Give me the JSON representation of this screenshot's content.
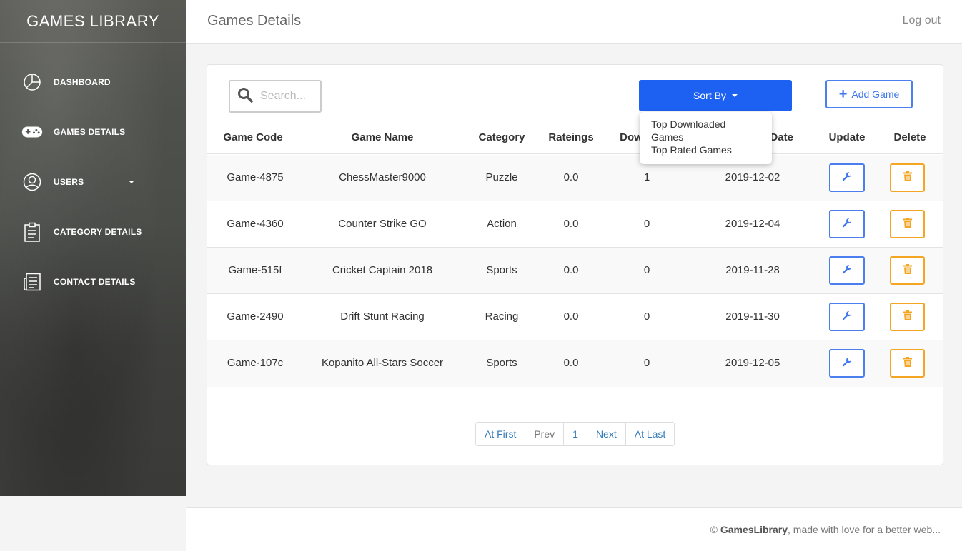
{
  "sidebar": {
    "brand": "GAMES LIBRARY",
    "items": [
      {
        "label": "DASHBOARD",
        "icon": "pie-chart-icon"
      },
      {
        "label": "GAMES DETAILS",
        "icon": "gamepad-icon"
      },
      {
        "label": "USERS",
        "icon": "user-icon"
      },
      {
        "label": "CATEGORY DETAILS",
        "icon": "clipboard-icon"
      },
      {
        "label": "CONTACT DETAILS",
        "icon": "news-icon"
      }
    ]
  },
  "header": {
    "title": "Games Details",
    "logout": "Log out"
  },
  "toolbar": {
    "search_placeholder": "Search...",
    "sort_label": "Sort By",
    "add_label": "Add Game",
    "sort_options": [
      "Top Downloaded Games",
      "Top Rated Games"
    ]
  },
  "table": {
    "columns": [
      "Game Code",
      "Game Name",
      "Category",
      "Rateings",
      "Dow",
      "d Date",
      "Update",
      "Delete"
    ],
    "rows": [
      {
        "code": "Game-4875",
        "name": "ChessMaster9000",
        "category": "Puzzle",
        "rating": "0.0",
        "downloads": "1",
        "date": "2019-12-02"
      },
      {
        "code": "Game-4360",
        "name": "Counter Strike GO",
        "category": "Action",
        "rating": "0.0",
        "downloads": "0",
        "date": "2019-12-04"
      },
      {
        "code": "Game-515f",
        "name": "Cricket Captain 2018",
        "category": "Sports",
        "rating": "0.0",
        "downloads": "0",
        "date": "2019-11-28"
      },
      {
        "code": "Game-2490",
        "name": "Drift Stunt Racing",
        "category": "Racing",
        "rating": "0.0",
        "downloads": "0",
        "date": "2019-11-30"
      },
      {
        "code": "Game-107c",
        "name": "Kopanito All-Stars Soccer",
        "category": "Sports",
        "rating": "0.0",
        "downloads": "0",
        "date": "2019-12-05"
      }
    ]
  },
  "pagination": {
    "first": "At First",
    "prev": "Prev",
    "page": "1",
    "next": "Next",
    "last": "At Last"
  },
  "footer": {
    "copyright": "©",
    "brand": "GamesLibrary",
    "tagline": ", made with love for a better web..."
  },
  "colors": {
    "primary": "#1d61f2",
    "update_border": "#4b7ff0",
    "delete_border": "#f4a623"
  }
}
